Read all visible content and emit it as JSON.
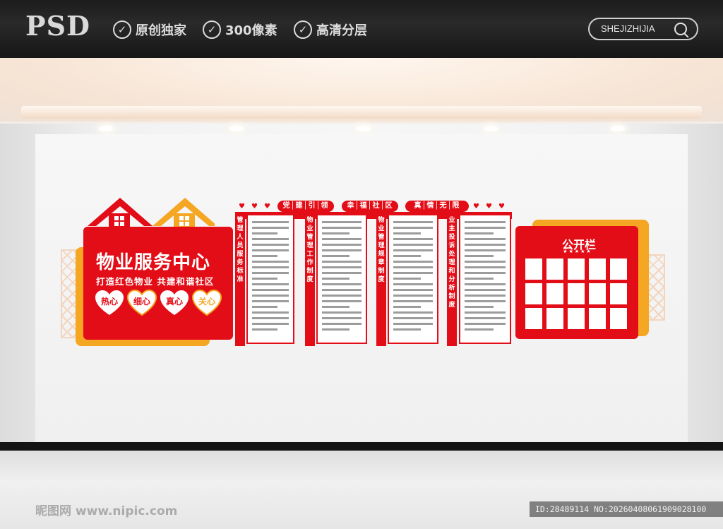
{
  "topbar": {
    "logo": "PSD",
    "features": [
      "原创独家",
      "300像素",
      "高清分层"
    ],
    "search_label": "SHEJIZHIJIA"
  },
  "display": {
    "main_title": "物业服务中心",
    "main_subtitle": "打造红色物业 共建和谐社区",
    "hearts": [
      "热心",
      "细心",
      "真心",
      "关心"
    ],
    "pills": [
      "党│建│引│领",
      "幸│福│社│区",
      "真│情│无│限"
    ],
    "columns": [
      "管理人员服务标准",
      "物业管理工作制度",
      "物业管理规章制度",
      "业主投诉处理和分析制度"
    ],
    "board_title": "公开栏",
    "board_stars": "★★★★★"
  },
  "colors": {
    "red": "#e30d17",
    "orange": "#f5a623"
  },
  "watermark": {
    "left": "昵图网 www.nipic.com",
    "right": "ID:28489114 NO:20260408061909028100"
  }
}
